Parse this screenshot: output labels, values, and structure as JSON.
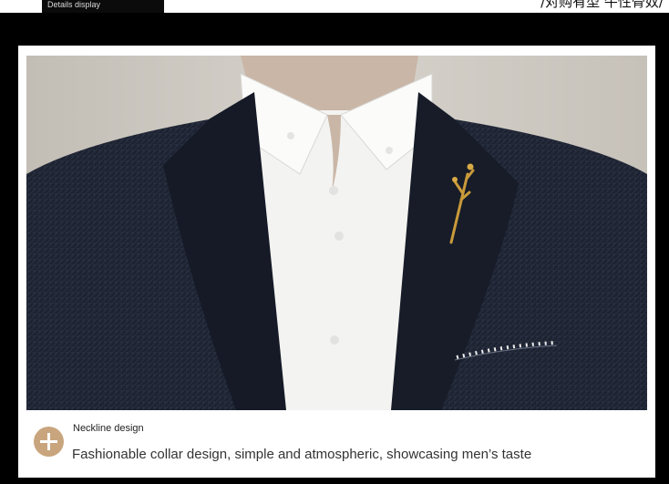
{
  "header": {
    "tab_label": "Details display",
    "cut_off_text": "/对购有型 牛性骨奴/"
  },
  "photo": {
    "subject": "suit-jacket-shirt-detail",
    "colors": {
      "background": "#cfcac2",
      "jacket": "#1c2230",
      "shirt": "#f4f4f2",
      "brooch": "#c99a3a"
    }
  },
  "caption": {
    "icon": "plus-icon",
    "accent_color": "#c9a57e",
    "title": "Neckline design",
    "description": "Fashionable collar design, simple and atmospheric, showcasing men’s taste"
  }
}
